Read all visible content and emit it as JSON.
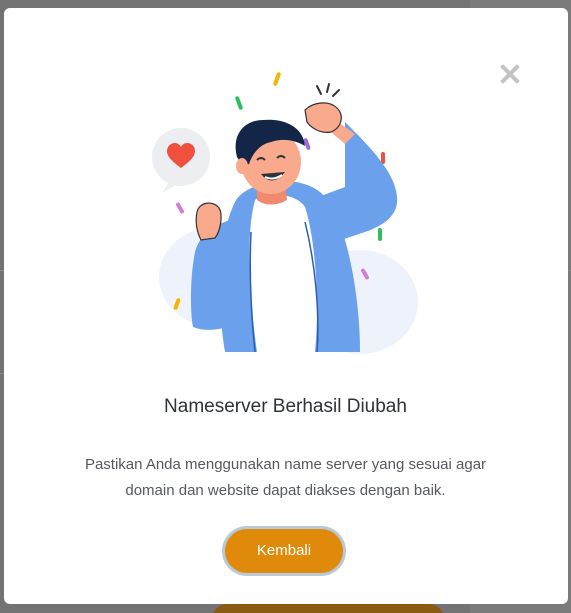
{
  "modal": {
    "title": "Nameserver Berhasil Diubah",
    "description_lines": [
      "Pastikan Anda menggunakan name server yang sesuai agar",
      "domain dan website dapat diakses dengan baik."
    ],
    "button_label": "Kembali",
    "close_icon": "close-icon",
    "illustration": "celebrating-person-illustration"
  },
  "colors": {
    "accent": "#e08a0b",
    "button_ring": "#b9c9d9",
    "title": "#2f3338",
    "text": "#55595e",
    "close_icon": "#c4c4c4"
  }
}
